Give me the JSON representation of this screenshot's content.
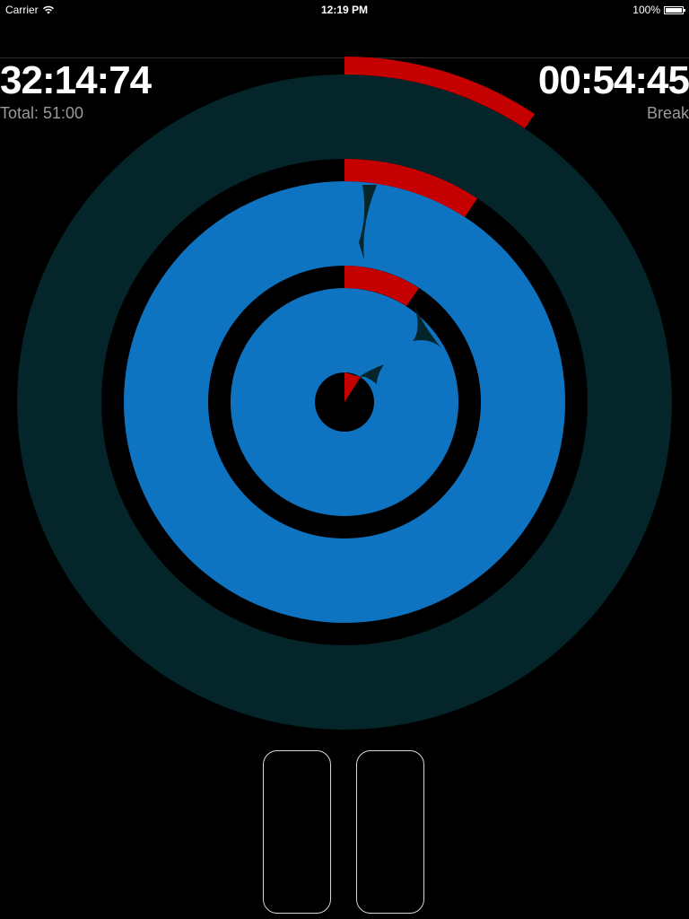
{
  "status_bar": {
    "carrier": "Carrier",
    "time": "12:19 PM",
    "battery": "100%",
    "icons": [
      "wifi-icon",
      "battery-icon"
    ]
  },
  "timer": {
    "elapsed": "32:14:74",
    "total_label": "Total: 51:00",
    "remaining": "00:54:45",
    "phase_label": "Break"
  },
  "dial": {
    "colors": {
      "outer_track": "#04252a",
      "inner_fill": "#0e73c0",
      "gap": "#000000",
      "progress": "#c40000"
    },
    "progress_fraction": {
      "outer_ring": 0.1,
      "middle_ring": 0.1,
      "inner_ring": 0.1,
      "center": 0.09
    }
  },
  "controls": {
    "icons": [
      "pause-left-bar",
      "pause-right-bar"
    ]
  }
}
